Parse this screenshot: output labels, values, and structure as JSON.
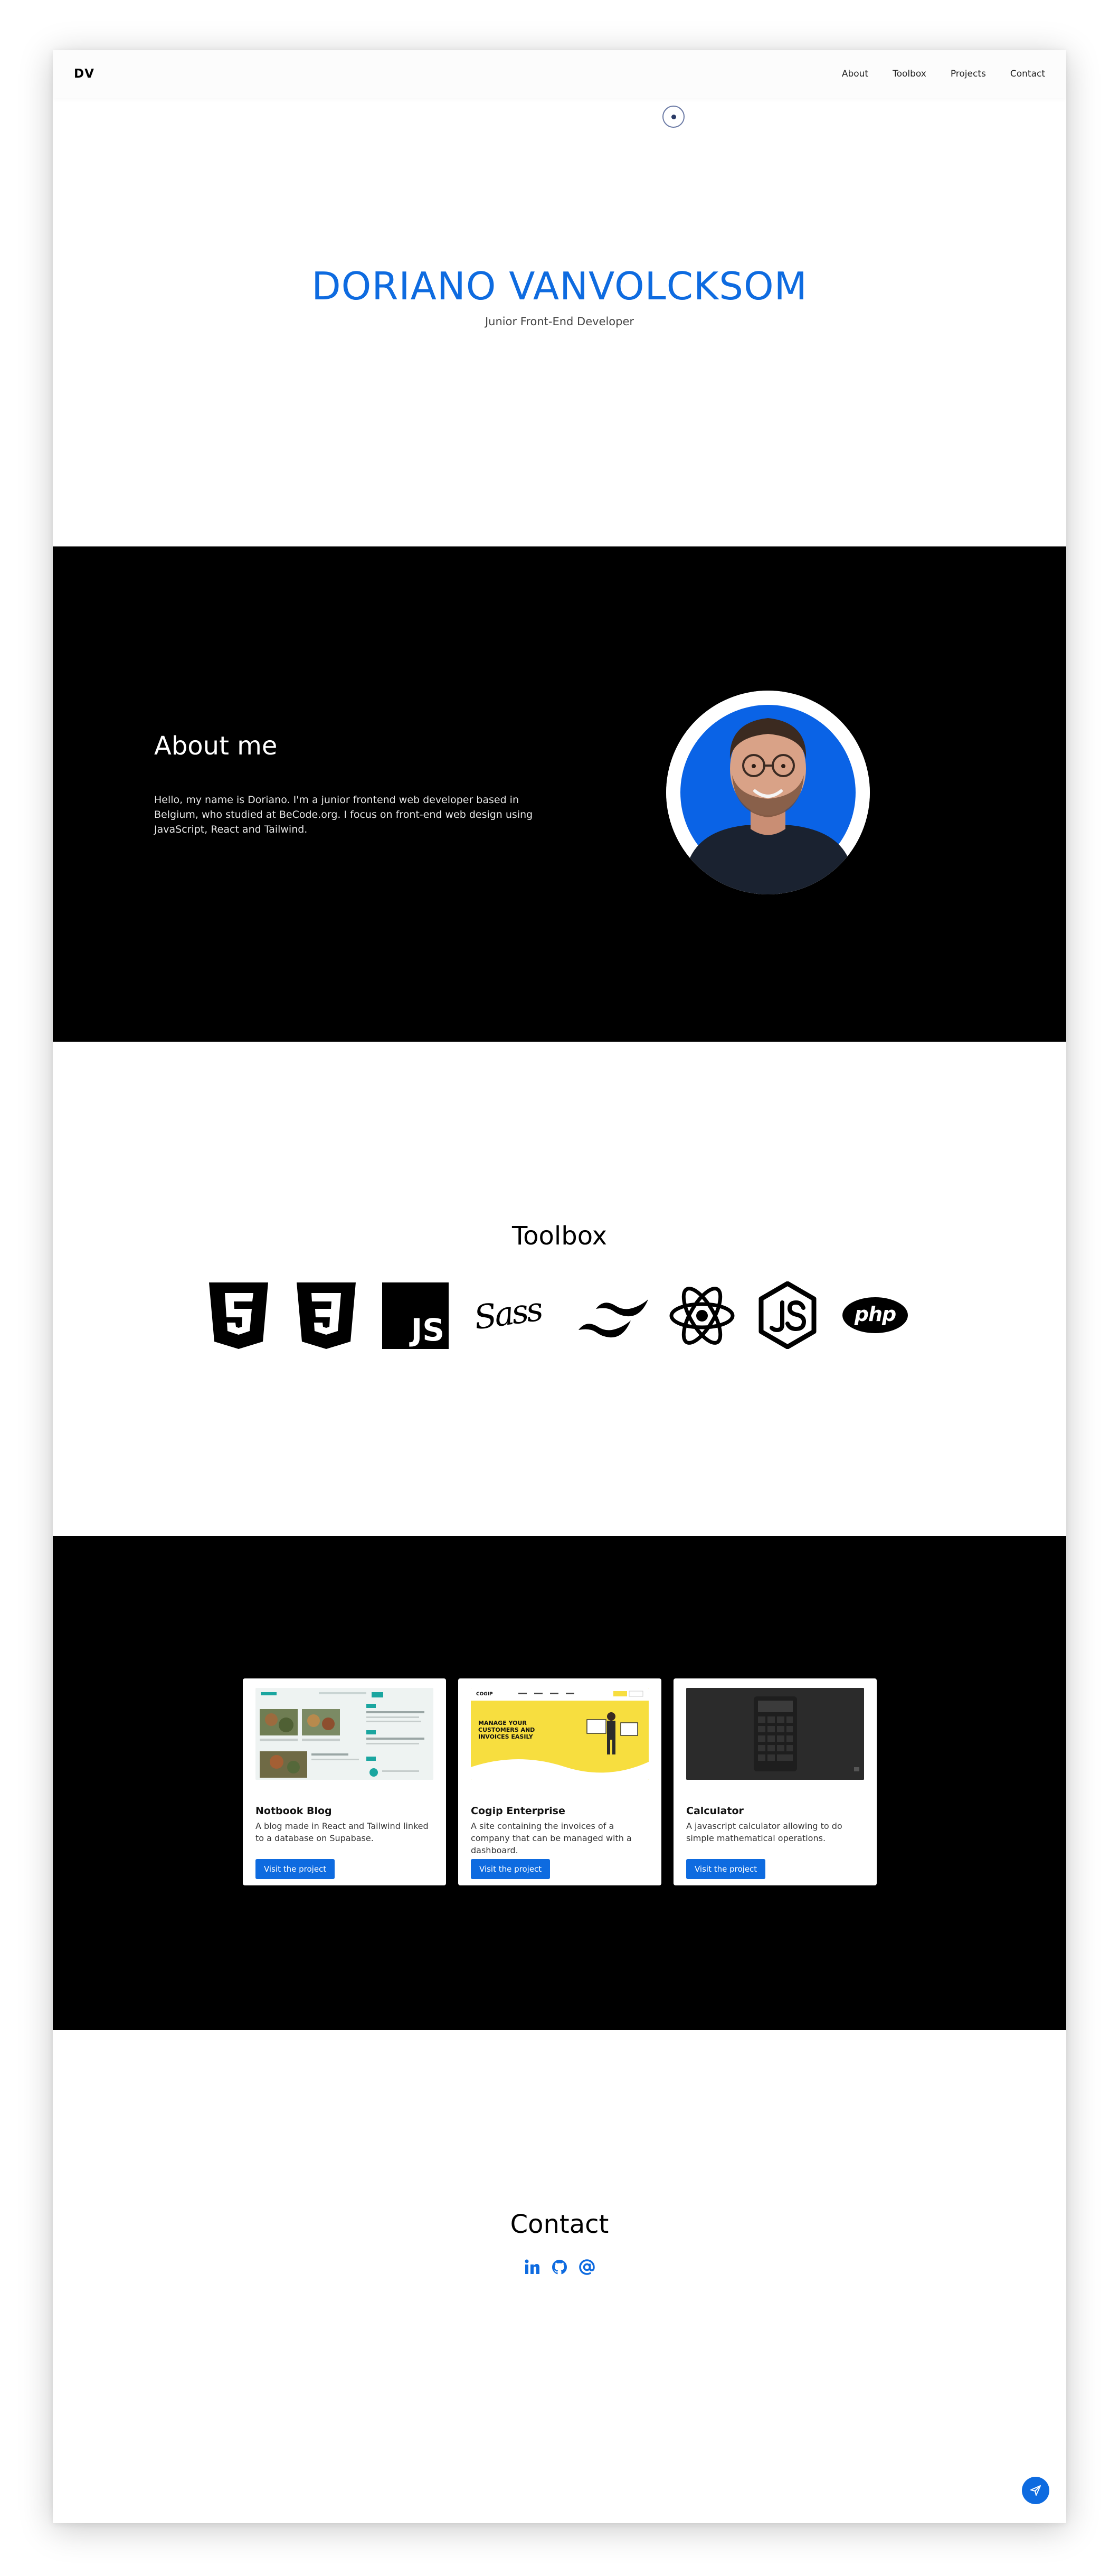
{
  "nav": {
    "logo": "DV",
    "links": [
      "About",
      "Toolbox",
      "Projects",
      "Contact"
    ]
  },
  "hero": {
    "name": "DORIANO VANVOLCKSOM",
    "subtitle": "Junior Front-End Developer",
    "scroll_icon": "scroll-down-icon"
  },
  "about": {
    "title": "About me",
    "text": "Hello, my name is Doriano. I'm a junior frontend web developer based in Belgium, who studied at BeCode.org. I focus on front-end web design using JavaScript, React and Tailwind.",
    "avatar_icon": "profile-photo"
  },
  "toolbox": {
    "title": "Toolbox",
    "tools": [
      "html5-icon",
      "css3-icon",
      "javascript-icon",
      "sass-icon",
      "tailwind-icon",
      "react-icon",
      "nodejs-icon",
      "php-icon"
    ],
    "labels": {
      "js": "JS",
      "sass": "Sass",
      "php": "php"
    }
  },
  "projects": {
    "items": [
      {
        "title": "Notbook Blog",
        "description": "A blog made in React and Tailwind linked to a database on Supabase.",
        "button": "Visit the project"
      },
      {
        "title": "Cogip Enterprise",
        "description": "A site containing the invoices of a company that can be managed with a dashboard.",
        "button": "Visit the project",
        "thumb_logo": "COGIP",
        "thumb_text": "MANAGE YOUR CUSTOMERS AND INVOICES EASILY"
      },
      {
        "title": "Calculator",
        "description": "A javascript calculator allowing to do simple mathematical operations.",
        "button": "Visit the project"
      }
    ]
  },
  "contact": {
    "title": "Contact",
    "icons": [
      "linkedin-icon",
      "github-icon",
      "email-at-icon"
    ],
    "fab_icon": "send-icon"
  },
  "colors": {
    "accent": "#0e6be0",
    "dark": "#000000",
    "light": "#ffffff"
  }
}
